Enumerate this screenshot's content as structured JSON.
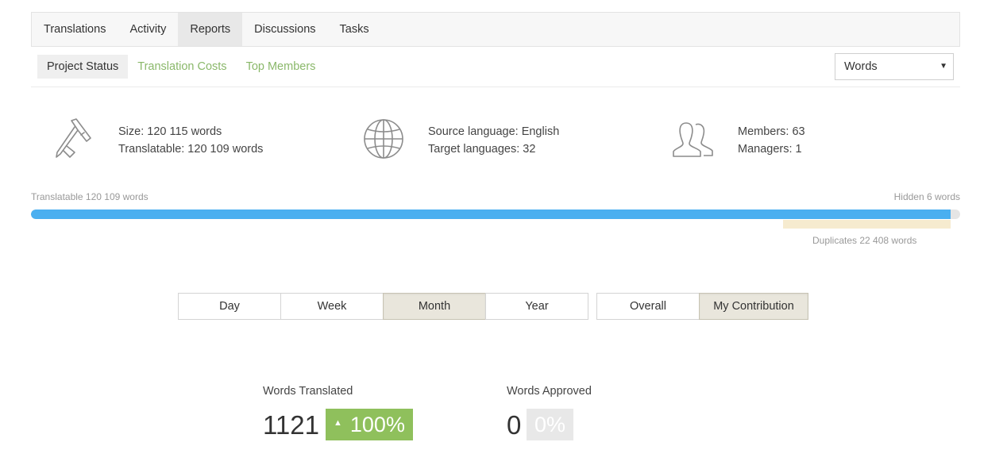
{
  "tabs": [
    "Translations",
    "Activity",
    "Reports",
    "Discussions",
    "Tasks"
  ],
  "active_tab": "Reports",
  "subnav": [
    "Project Status",
    "Translation Costs",
    "Top Members"
  ],
  "active_subnav": "Project Status",
  "unit_select": {
    "value": "Words"
  },
  "stats": {
    "size": "Size: 120 115 words",
    "translatable": "Translatable: 120 109 words",
    "source_language": "Source language: English",
    "target_languages": "Target languages: 32",
    "members": "Members: 63",
    "managers": "Managers: 1"
  },
  "progress": {
    "translatable_label": "Translatable 120 109 words",
    "hidden_label": "Hidden 6 words",
    "duplicates_label": "Duplicates 22 408 words",
    "translatable_fraction": 0.99
  },
  "period_buttons": [
    "Day",
    "Week",
    "Month",
    "Year"
  ],
  "active_period": "Month",
  "scope_buttons": [
    "Overall",
    "My Contribution"
  ],
  "active_scope": "My Contribution",
  "metrics": {
    "translated": {
      "label": "Words Translated",
      "value": "1121",
      "change": "100%"
    },
    "approved": {
      "label": "Words Approved",
      "value": "0",
      "change": "0%"
    }
  },
  "colors": {
    "accent_green": "#8fc05c",
    "progress_blue": "#4aaff0",
    "duplicates_beige": "#f6ebcf"
  },
  "icons": [
    "caliper-icon",
    "globe-icon",
    "members-icon",
    "triangle-up-icon",
    "dropdown-caret-icon"
  ]
}
